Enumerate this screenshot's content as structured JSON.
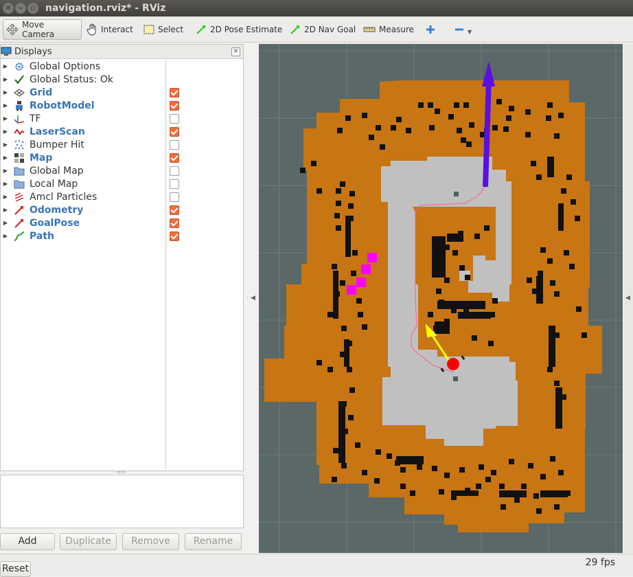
{
  "window": {
    "title": "navigation.rviz* - RViz"
  },
  "toolbar": {
    "move_camera": "Move Camera",
    "interact": "Interact",
    "select": "Select",
    "pose_estimate": "2D Pose Estimate",
    "nav_goal": "2D Nav Goal",
    "measure": "Measure"
  },
  "displays": {
    "title": "Displays",
    "items": [
      {
        "label": "Global Options",
        "bold": false,
        "checked": null,
        "icon": "gear-icon"
      },
      {
        "label": "Global Status: Ok",
        "bold": false,
        "checked": null,
        "icon": "checkmark-icon"
      },
      {
        "label": "Grid",
        "bold": true,
        "checked": true,
        "icon": "grid-icon"
      },
      {
        "label": "RobotModel",
        "bold": true,
        "checked": true,
        "icon": "robot-icon"
      },
      {
        "label": "TF",
        "bold": false,
        "checked": false,
        "icon": "axes-icon"
      },
      {
        "label": "LaserScan",
        "bold": true,
        "checked": true,
        "icon": "laser-icon"
      },
      {
        "label": "Bumper Hit",
        "bold": false,
        "checked": false,
        "icon": "dots-icon"
      },
      {
        "label": "Map",
        "bold": true,
        "checked": true,
        "icon": "map-icon"
      },
      {
        "label": "Global Map",
        "bold": false,
        "checked": false,
        "icon": "folder-icon"
      },
      {
        "label": "Local Map",
        "bold": false,
        "checked": false,
        "icon": "folder-icon"
      },
      {
        "label": "Amcl Particles",
        "bold": false,
        "checked": false,
        "icon": "particles-icon"
      },
      {
        "label": "Odometry",
        "bold": true,
        "checked": true,
        "icon": "odometry-icon"
      },
      {
        "label": "GoalPose",
        "bold": true,
        "checked": true,
        "icon": "goal-pose-icon"
      },
      {
        "label": "Path",
        "bold": true,
        "checked": true,
        "icon": "path-icon"
      }
    ]
  },
  "panel_buttons": {
    "add": "Add",
    "duplicate": "Duplicate",
    "remove": "Remove",
    "rename": "Rename"
  },
  "status": {
    "reset": "Reset",
    "fps": "29 fps"
  },
  "colors": {
    "accent": "#3a74b7",
    "checked": "#ec6e3f",
    "costmap": "#c87514",
    "free": "#c0c0c0",
    "background": "#5a6868",
    "robot": "#ff0000",
    "goal_arrow": "#5a10e0",
    "pose_arrow": "#ffff00",
    "laser": "#ff00ff"
  }
}
